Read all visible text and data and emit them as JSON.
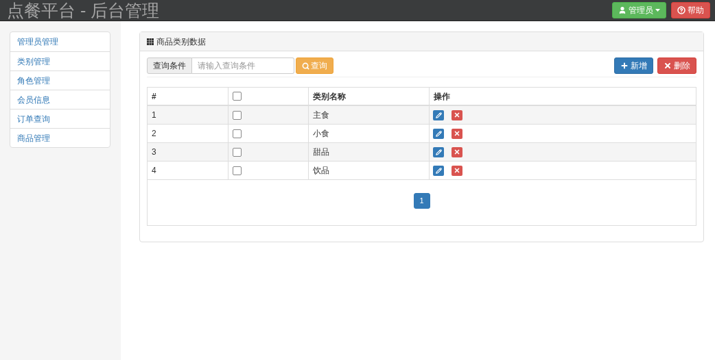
{
  "header": {
    "title": "点餐平台 - 后台管理",
    "user_button": "管理员",
    "help_button": "帮助"
  },
  "sidebar": {
    "items": [
      {
        "label": "管理员管理",
        "selected": false
      },
      {
        "label": "类别管理",
        "selected": false
      },
      {
        "label": "角色管理",
        "selected": false
      },
      {
        "label": "会员信息",
        "selected": false
      },
      {
        "label": "订单查询",
        "selected": false
      },
      {
        "label": "商品管理",
        "selected": false
      }
    ]
  },
  "panel": {
    "title": "商品类别数据",
    "search": {
      "label": "查询条件",
      "placeholder": "请输入查询条件",
      "button": "查询"
    },
    "actions": {
      "add": "新增",
      "delete": "删除"
    },
    "table": {
      "columns": [
        {
          "label": "#",
          "kind": "text"
        },
        {
          "kind": "checkbox",
          "checked": false
        },
        {
          "label": "类别名称",
          "kind": "text"
        },
        {
          "label": "操作",
          "kind": "text"
        }
      ],
      "rows": [
        {
          "index": "1",
          "checked": false,
          "name": "主食"
        },
        {
          "index": "2",
          "checked": false,
          "name": "小食"
        },
        {
          "index": "3",
          "checked": false,
          "name": "甜品"
        },
        {
          "index": "4",
          "checked": false,
          "name": "饮品"
        }
      ]
    },
    "pagination": [
      {
        "label": "1",
        "selected": true
      }
    ]
  }
}
